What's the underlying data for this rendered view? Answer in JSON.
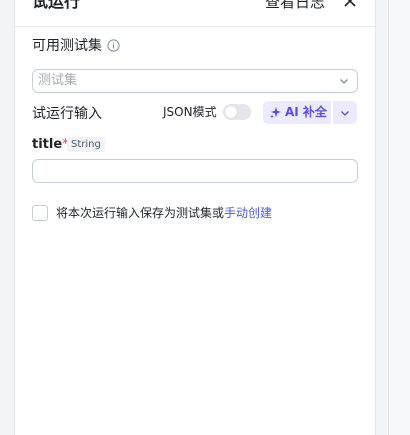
{
  "header": {
    "title": "试运行",
    "logs_label": "查看日志"
  },
  "test_set": {
    "label": "可用测试集",
    "placeholder": "测试集"
  },
  "run_input": {
    "label": "试运行输入",
    "json_mode_label": "JSON模式",
    "json_mode_enabled": false,
    "ai_button_label": "AI 补全"
  },
  "fields": [
    {
      "name": "title",
      "required_mark": "*",
      "type": "String",
      "value": ""
    }
  ],
  "save_option": {
    "checked": false,
    "text": "将本次运行输入保存为测试集或",
    "link": "手动创建"
  },
  "colors": {
    "accent": "#5b4fe0",
    "accent_bg": "#eceaff",
    "link": "#4c5ae8",
    "required": "#f53f3f"
  }
}
